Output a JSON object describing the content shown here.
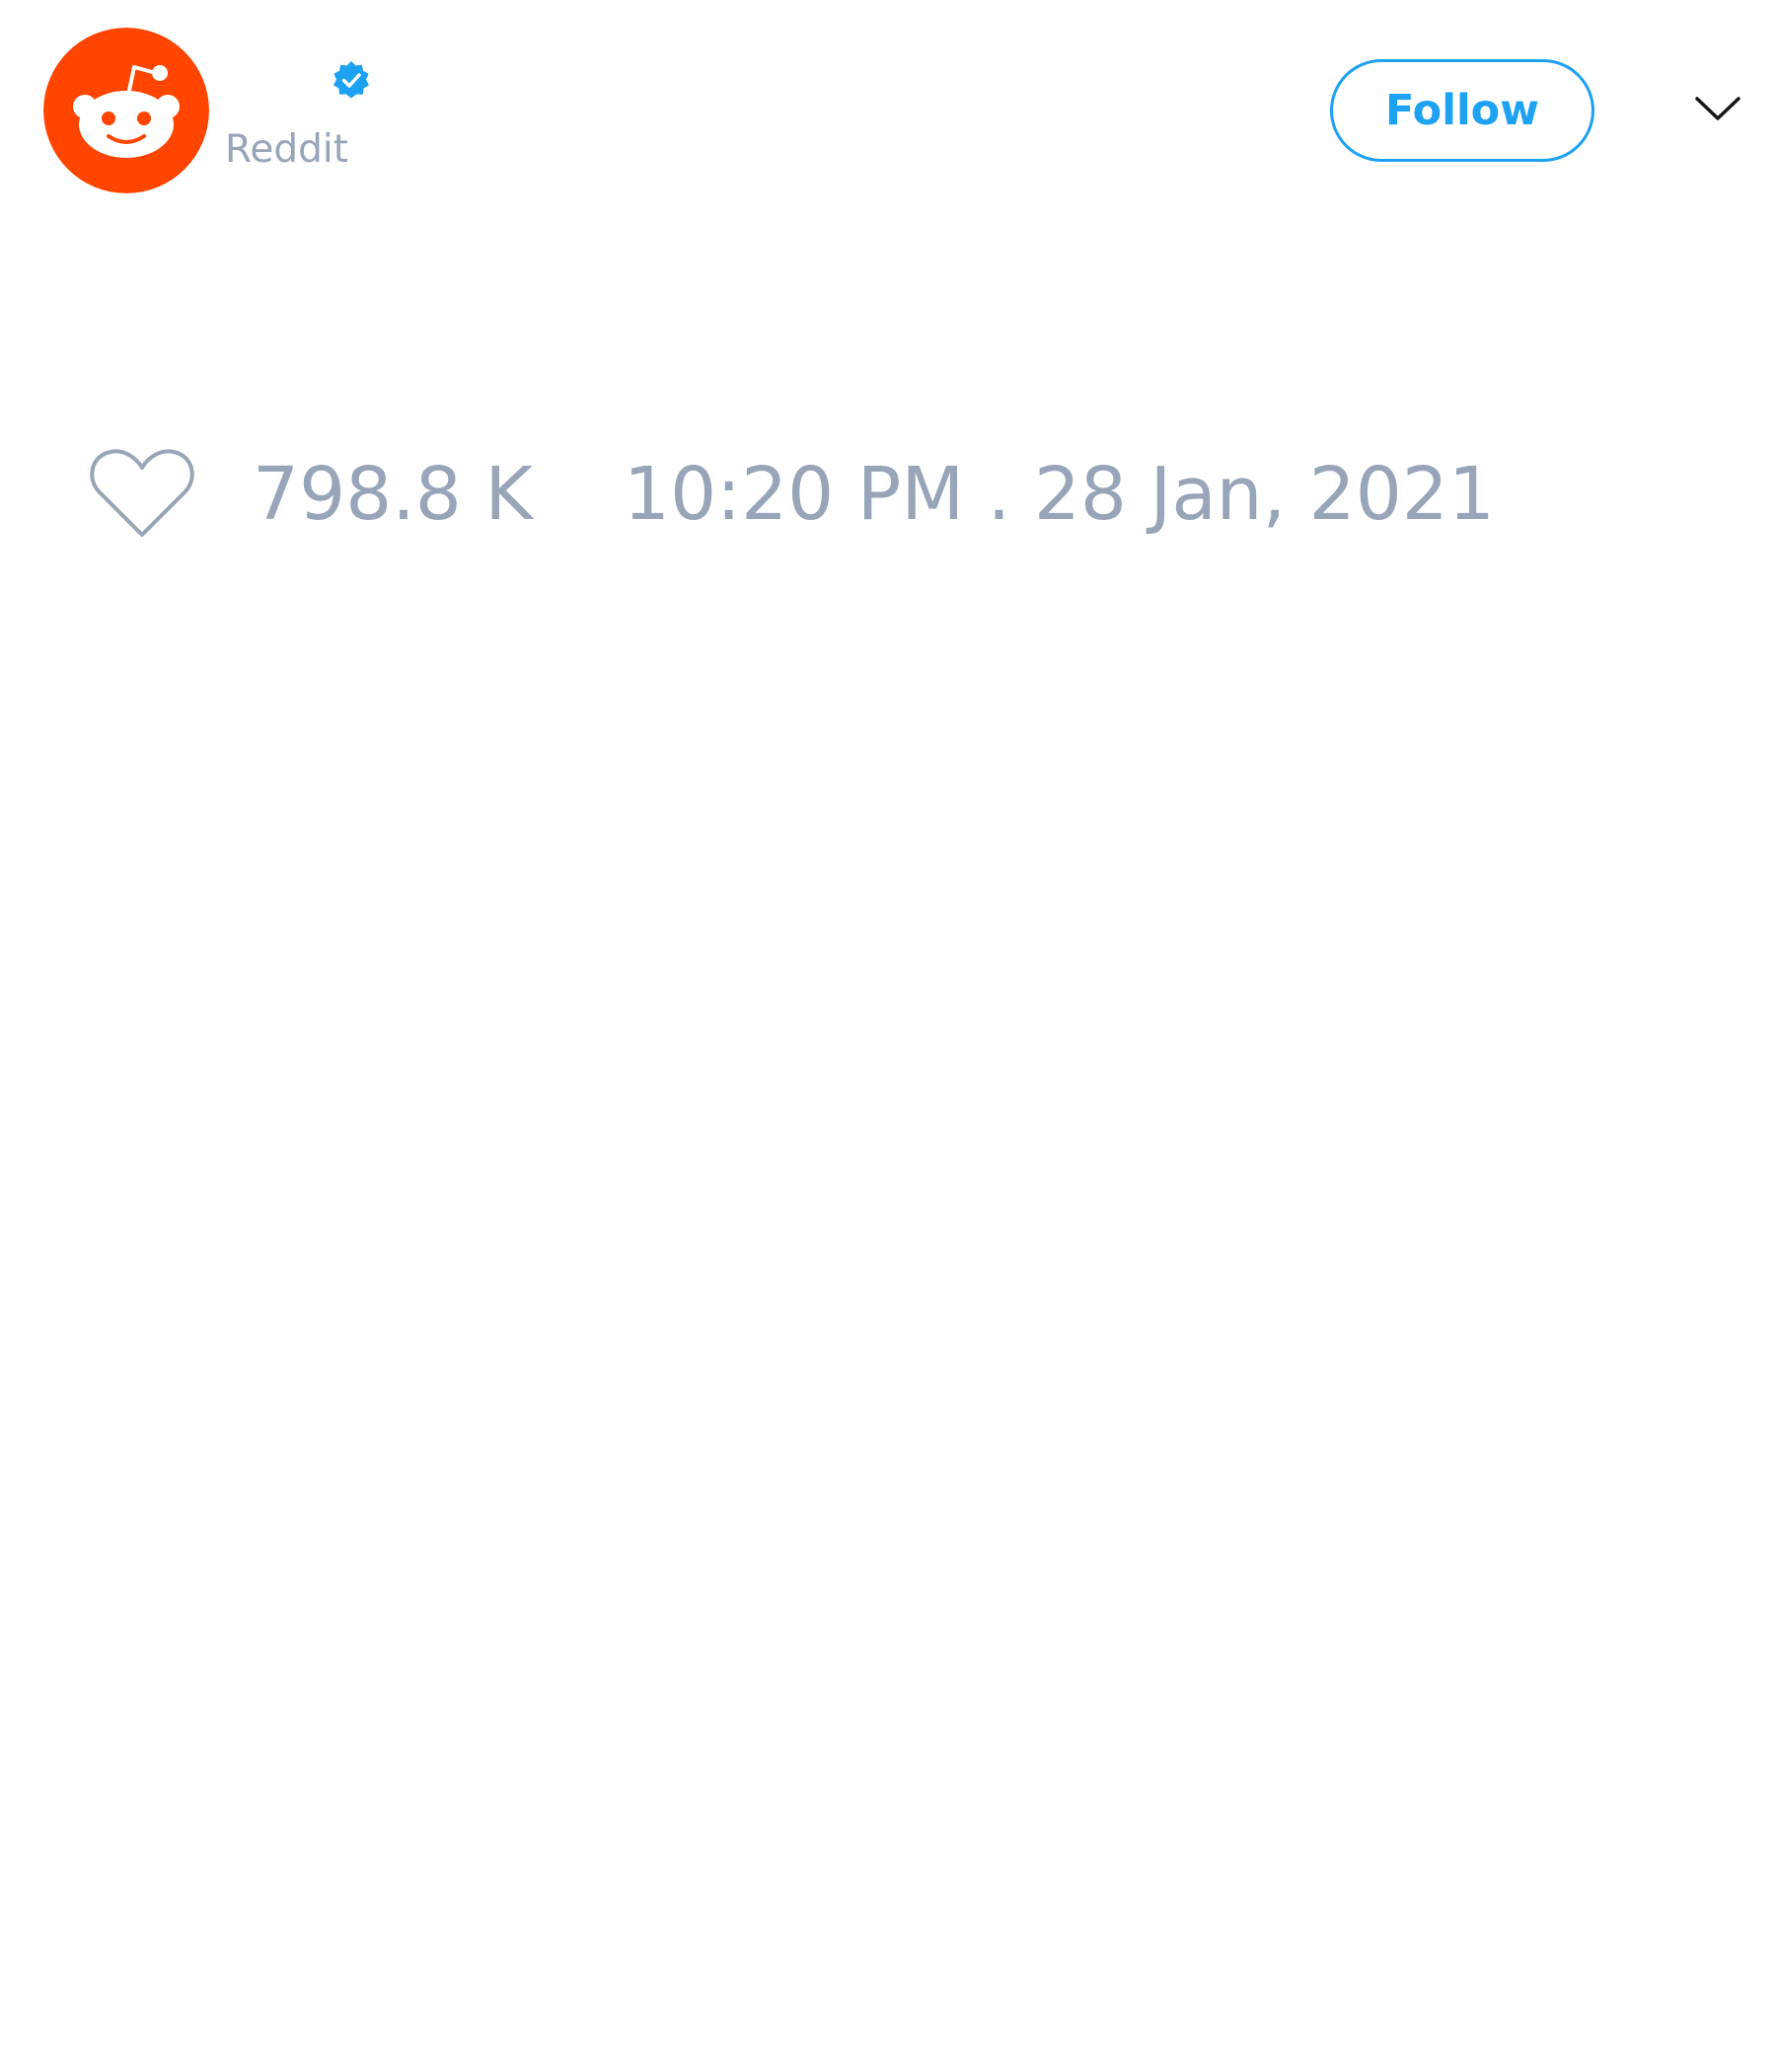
{
  "tweet": {
    "author": {
      "display_name": "",
      "handle": "Reddit",
      "verified": true,
      "avatar_icon": "reddit-snoo-icon",
      "avatar_color": "#ff4500"
    },
    "follow_label": "Follow",
    "menu_icon": "chevron-down-icon",
    "like_icon": "heart-icon",
    "like_count": "798.8 K",
    "timestamp": "10:20 PM . 28 Jan, 2021"
  },
  "colors": {
    "accent": "#1da1f2",
    "muted_text": "#98a4b8",
    "background": "#ffffff"
  }
}
